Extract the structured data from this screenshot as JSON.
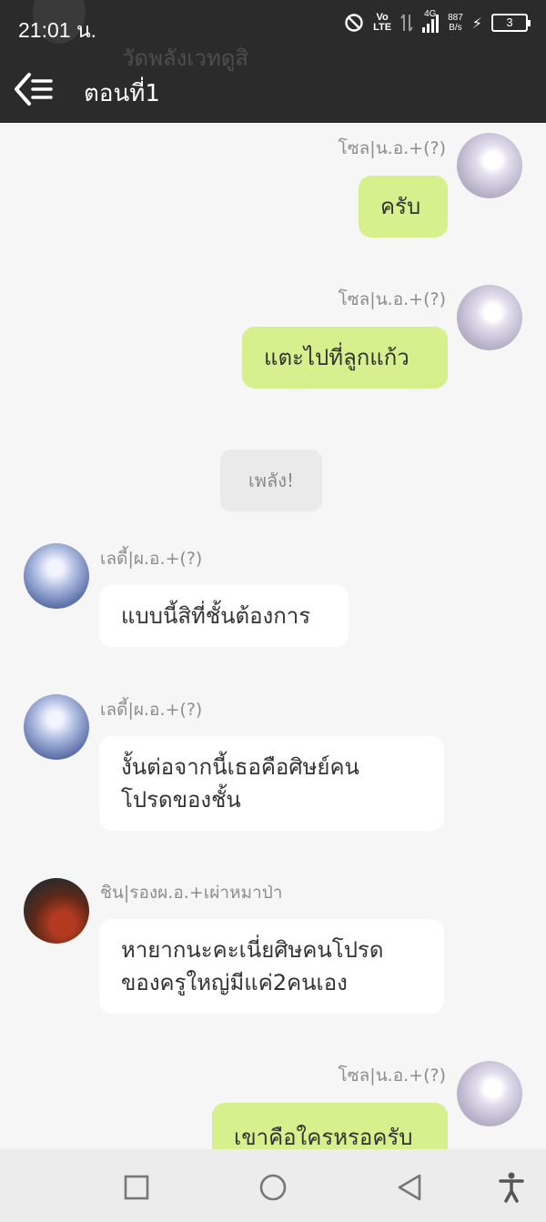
{
  "status_bar": {
    "time": "21:01 น.",
    "network_top": "Vo",
    "network_bottom": "LTE",
    "network_type": "4G",
    "speed_value": "887",
    "speed_unit": "B/s",
    "battery_level": "3"
  },
  "header": {
    "title": "ตอนที่1",
    "ghost_subtitle": "วัดพลังเวทดูสิ"
  },
  "messages": [
    {
      "sender": "โซล|น.อ.+(?)",
      "side": "right",
      "text": "ครับ"
    },
    {
      "sender": "โซล|น.อ.+(?)",
      "side": "right",
      "text": "แตะไปที่ลูกแก้ว"
    },
    {
      "side": "center",
      "text": "เพลัง!"
    },
    {
      "sender": "เลดี้|ผ.อ.+(?)",
      "side": "left",
      "text": "แบบนี้สิที่ชั้นต้องการ"
    },
    {
      "sender": "เลดี้|ผ.อ.+(?)",
      "side": "left",
      "lines": [
        "งั้นต่อจากนี้เธอคือศิษย์คน",
        "โปรดของชั้น"
      ]
    },
    {
      "sender": "ชิน|รองผ.อ.+เผ่าหมาป่า",
      "side": "left",
      "lines": [
        "หายากนะคะเนี่ยศิษคนโปรด",
        "ของครูใหญ่มีแค่2คนเอง"
      ]
    },
    {
      "sender": "โซล|น.อ.+(?)",
      "side": "right",
      "text": "เขาคือใครหรอครับ"
    }
  ],
  "colors": {
    "header_bg": "#2b2b2b",
    "my_bubble": "#d5f08c",
    "other_bubble": "#ffffff",
    "system_bubble": "#eaeaea",
    "chat_bg": "#f6f6f6"
  },
  "navigation": {
    "recents": "square-icon",
    "home": "circle-icon",
    "back": "triangle-back-icon",
    "accessibility": "accessibility-icon"
  }
}
